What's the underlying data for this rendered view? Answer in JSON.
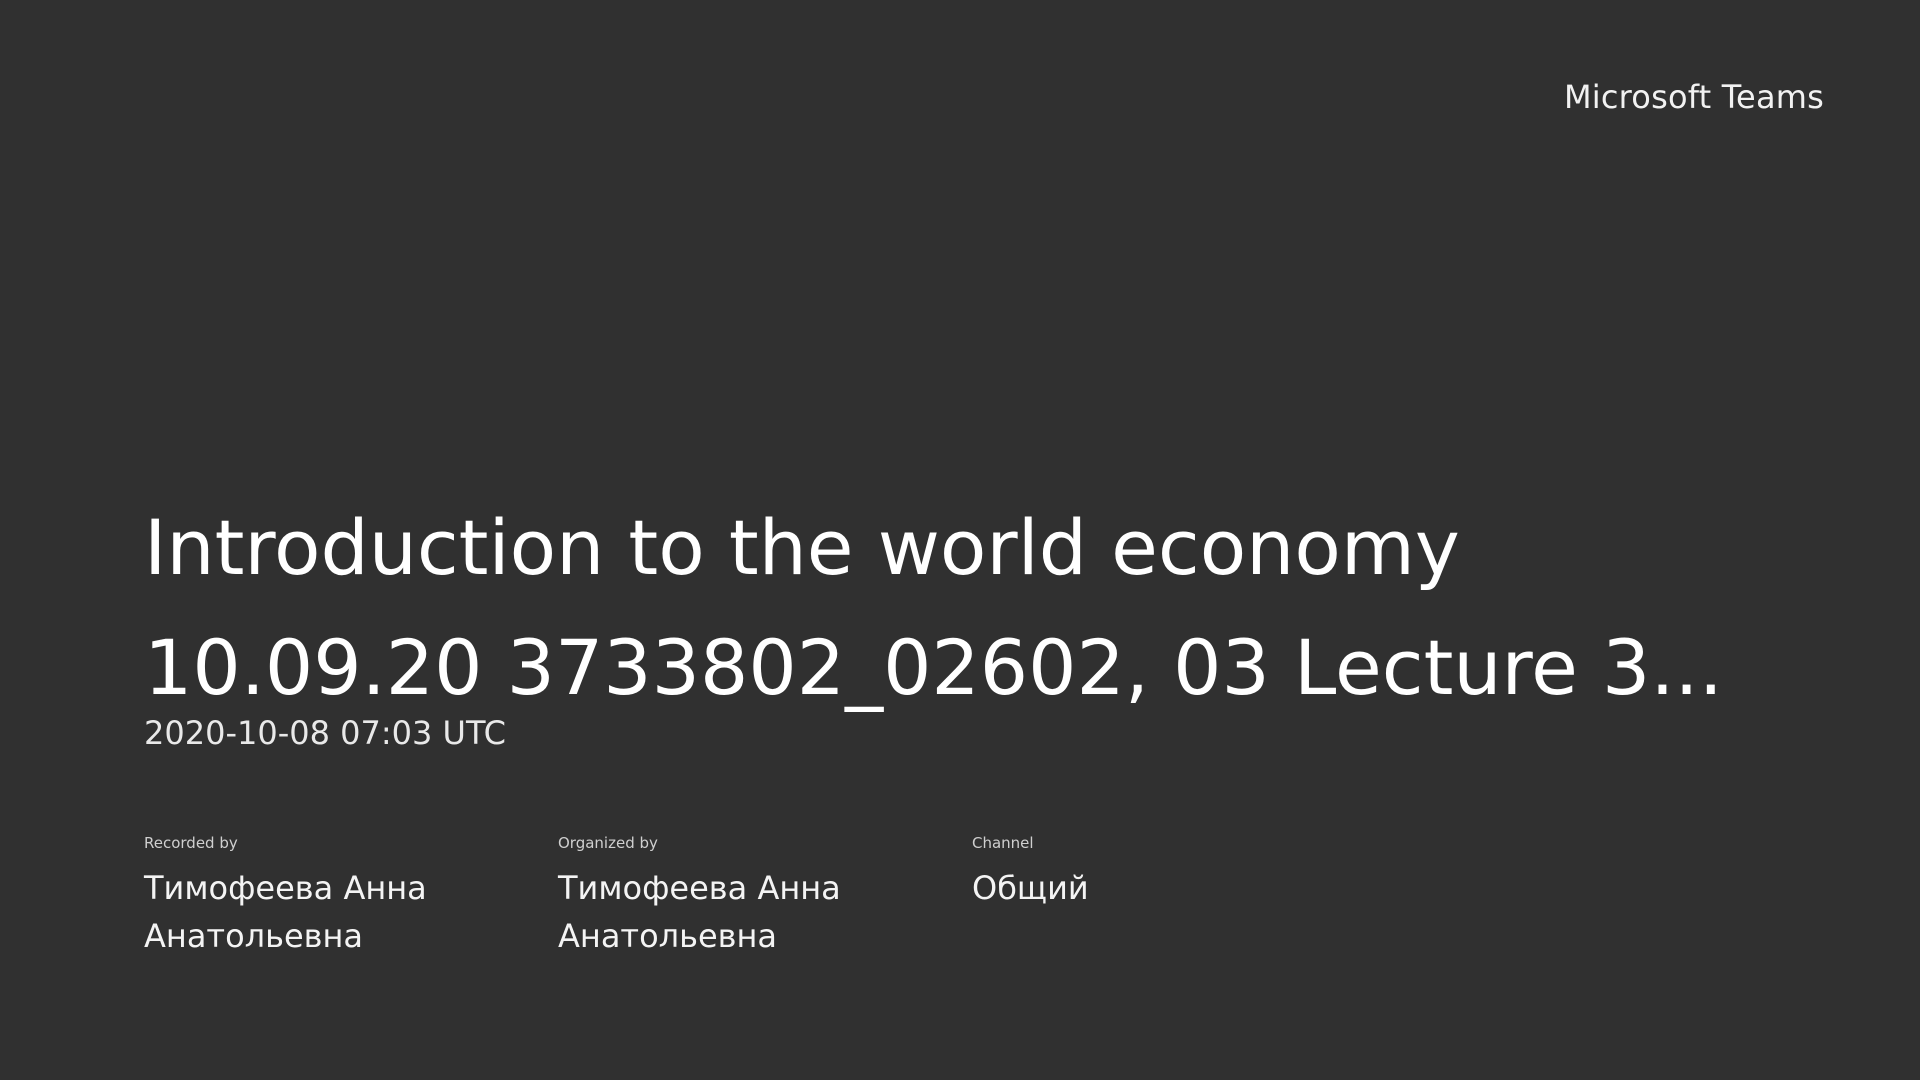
{
  "brand": "Microsoft Teams",
  "title": {
    "line1": "Introduction to the world economy",
    "line2": "10.09.20 3733802_02602, 03 Lecture 3..."
  },
  "date": "2020-10-08 07:03 UTC",
  "meta": {
    "recorded_by": {
      "label": "Recorded by",
      "value": "Тимофеева Анна Анатольевна"
    },
    "organized_by": {
      "label": "Organized by",
      "value": "Тимофеева Анна Анатольевна"
    },
    "channel": {
      "label": "Channel",
      "value": "Общий"
    }
  },
  "colors": {
    "background": "#303030",
    "text": "#ffffff"
  }
}
